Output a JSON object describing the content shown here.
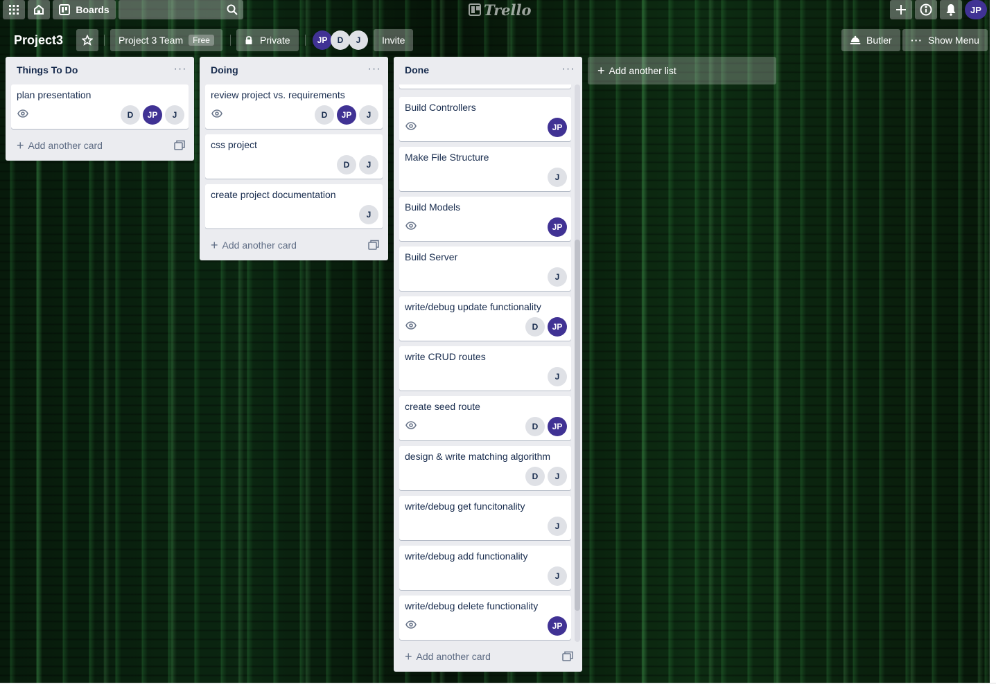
{
  "topbar": {
    "boards_label": "Boards",
    "search_placeholder": "",
    "logo_text": "Trello",
    "user_initials": "JP"
  },
  "board": {
    "title": "Project3",
    "team_label": "Project 3 Team",
    "team_badge": "Free",
    "visibility_label": "Private",
    "members": [
      "JP",
      "D",
      "J"
    ],
    "invite_label": "Invite",
    "butler_label": "Butler",
    "show_menu_label": "Show Menu",
    "add_list_label": "Add another list"
  },
  "lists": [
    {
      "title": "Things To Do",
      "add_card_label": "Add another card",
      "cards": [
        {
          "title": "plan presentation",
          "watch": true,
          "members": [
            "D",
            "JP",
            "J"
          ]
        }
      ]
    },
    {
      "title": "Doing",
      "add_card_label": "Add another card",
      "cards": [
        {
          "title": "review project vs. requirements",
          "watch": true,
          "members": [
            "D",
            "JP",
            "J"
          ]
        },
        {
          "title": "css project",
          "watch": false,
          "members": [
            "D",
            "J"
          ]
        },
        {
          "title": "create project documentation",
          "watch": false,
          "members": [
            "J"
          ]
        }
      ]
    },
    {
      "title": "Done",
      "add_card_label": "Add another card",
      "cards": [
        {
          "title": "Build Controllers",
          "watch": true,
          "members": [
            "JP"
          ]
        },
        {
          "title": "Make File Structure",
          "watch": false,
          "members": [
            "J"
          ]
        },
        {
          "title": "Build Models",
          "watch": true,
          "members": [
            "JP"
          ]
        },
        {
          "title": "Build Server",
          "watch": false,
          "members": [
            "J"
          ]
        },
        {
          "title": "write/debug update functionality",
          "watch": true,
          "members": [
            "D",
            "JP"
          ]
        },
        {
          "title": "write CRUD routes",
          "watch": false,
          "members": [
            "J"
          ]
        },
        {
          "title": "create seed route",
          "watch": true,
          "members": [
            "D",
            "JP"
          ]
        },
        {
          "title": "design & write matching algorithm",
          "watch": false,
          "members": [
            "D",
            "J"
          ]
        },
        {
          "title": "write/debug get funcitonality",
          "watch": false,
          "members": [
            "J"
          ]
        },
        {
          "title": "write/debug add functionality",
          "watch": false,
          "members": [
            "J"
          ]
        },
        {
          "title": "write/debug delete functionality",
          "watch": true,
          "members": [
            "JP"
          ]
        }
      ]
    }
  ],
  "colors": {
    "list_bg": "#ebecf0",
    "avatar_jp": "#403294",
    "avatar_gray": "#dfe1e6"
  }
}
